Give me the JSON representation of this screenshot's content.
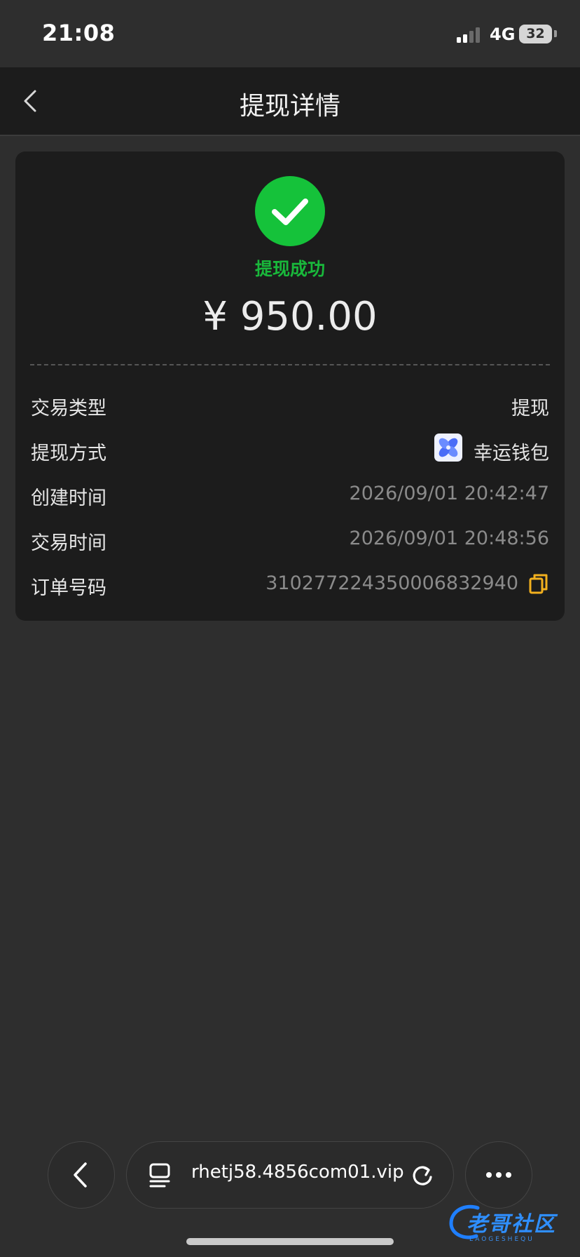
{
  "status_bar": {
    "time": "21:08",
    "network": "4G",
    "battery": "32"
  },
  "nav": {
    "title": "提现详情",
    "back_icon": "chevron-left-icon"
  },
  "withdrawal": {
    "status": "提现成功",
    "status_color": "#19b83b",
    "amount": "¥ 950.00",
    "rows": [
      {
        "label": "交易类型",
        "value": "提现"
      },
      {
        "label": "提现方式",
        "value": "幸运钱包",
        "icon": "wallet-logo-icon"
      },
      {
        "label": "创建时间",
        "value": "2026/09/01 20:42:47"
      },
      {
        "label": "交易时间",
        "value": "2026/09/01 20:48:56"
      },
      {
        "label": "订单号码",
        "value": "3102772243500068329­40",
        "action_icon": "copy-icon"
      }
    ]
  },
  "browser_toolbar": {
    "url": "rhetj58.4856com01.vip"
  },
  "watermark": {
    "text": "老哥社区",
    "subtext": "LAOGESHEQU"
  },
  "colors": {
    "accent_green": "#15c23a",
    "copy_icon": "#f2b01e",
    "background": "#2e2e2e",
    "card": "#1c1c1c"
  }
}
